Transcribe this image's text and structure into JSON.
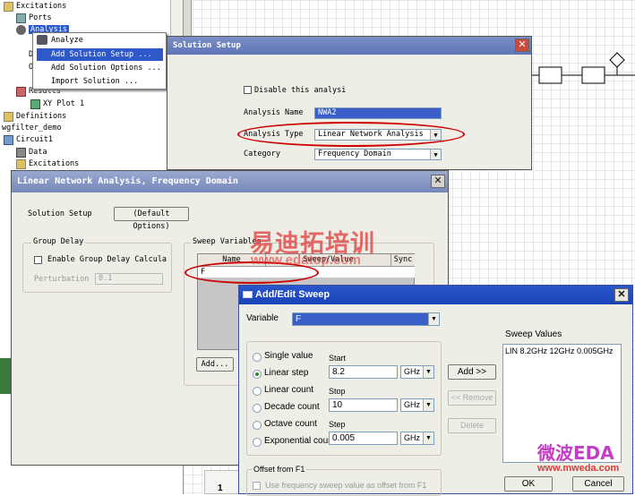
{
  "tree": {
    "excitations_top": "Excitations",
    "ports": "Ports",
    "analysis": "Analysis",
    "d": "D",
    "o": "O",
    "results": "Results",
    "xyplot": "XY Plot 1",
    "definitions": "Definitions",
    "project": "wgfilter_demo",
    "circuit": "Circuit1",
    "data": "Data",
    "excitations_bottom": "Excitations"
  },
  "context_menu": {
    "analyze": "Analyze",
    "add_setup": "Add Solution Setup ...",
    "add_options": "Add Solution Options ...",
    "import": "Import Solution ..."
  },
  "solution_setup": {
    "title": "Solution Setup",
    "disable": "Disable this analysi",
    "name_label": "Analysis Name",
    "name_value": "NWA2",
    "type_label": "Analysis Type",
    "type_value": "Linear Network Analysis",
    "category_label": "Category",
    "category_value": "Frequency Domain"
  },
  "lna": {
    "title": "Linear Network Analysis, Frequency Domain",
    "solution_setup": "Solution Setup",
    "default_options": "(Default Options)",
    "group_delay": "Group Delay",
    "enable_gd": "Enable Group Delay Calcula",
    "perturbation": "Perturbation",
    "perturbation_value": "0.1",
    "sweep_variables": "Sweep Variables",
    "col_name": "Name",
    "col_sweep": "Sweep/Value",
    "col_sync": "Sync",
    "row_name": "F",
    "add": "Add..."
  },
  "sweep": {
    "title": "Add/Edit Sweep",
    "variable_label": "Variable",
    "variable_value": "F",
    "options": {
      "single": "Single value",
      "linear_step": "Linear step",
      "linear_count": "Linear count",
      "decade": "Decade count",
      "octave": "Octave count",
      "exponential": "Exponential count"
    },
    "start_label": "Start",
    "start_value": "8.2",
    "stop_label": "Stop",
    "stop_value": "10",
    "step_label": "Step",
    "step_value": "0.005",
    "unit": "GHz",
    "add": "Add >>",
    "remove": "<< Remove",
    "delete": "Delete",
    "values_label": "Sweep Values",
    "values_text": "LIN 8.2GHz 12GHz 0.005GHz",
    "offset_group": "Offset from F1",
    "offset_check": "Use frequency sweep value as offset from F1",
    "ok": "OK",
    "cancel": "Cancel"
  },
  "watermark": {
    "cn_title": "易迪拓培训",
    "url1": "www.edatop.com",
    "eda_logo": "微波EDA",
    "url2": "www.mweda.com"
  },
  "misc": {
    "page_num": "1"
  },
  "colors": {
    "title_bar": "#6a7fbd",
    "highlight_red": "#cc0000",
    "menu_select": "#2f59c9",
    "watermark_red": "#e03a3a"
  }
}
